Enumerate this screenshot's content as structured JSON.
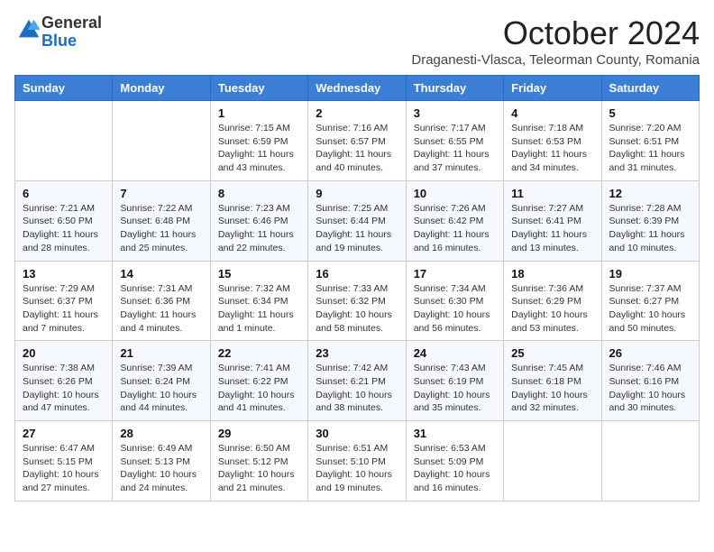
{
  "header": {
    "logo_general": "General",
    "logo_blue": "Blue",
    "month_title": "October 2024",
    "subtitle": "Draganesti-Vlasca, Teleorman County, Romania"
  },
  "days_of_week": [
    "Sunday",
    "Monday",
    "Tuesday",
    "Wednesday",
    "Thursday",
    "Friday",
    "Saturday"
  ],
  "weeks": [
    [
      {
        "day": "",
        "info": ""
      },
      {
        "day": "",
        "info": ""
      },
      {
        "day": "1",
        "info": "Sunrise: 7:15 AM\nSunset: 6:59 PM\nDaylight: 11 hours and 43 minutes."
      },
      {
        "day": "2",
        "info": "Sunrise: 7:16 AM\nSunset: 6:57 PM\nDaylight: 11 hours and 40 minutes."
      },
      {
        "day": "3",
        "info": "Sunrise: 7:17 AM\nSunset: 6:55 PM\nDaylight: 11 hours and 37 minutes."
      },
      {
        "day": "4",
        "info": "Sunrise: 7:18 AM\nSunset: 6:53 PM\nDaylight: 11 hours and 34 minutes."
      },
      {
        "day": "5",
        "info": "Sunrise: 7:20 AM\nSunset: 6:51 PM\nDaylight: 11 hours and 31 minutes."
      }
    ],
    [
      {
        "day": "6",
        "info": "Sunrise: 7:21 AM\nSunset: 6:50 PM\nDaylight: 11 hours and 28 minutes."
      },
      {
        "day": "7",
        "info": "Sunrise: 7:22 AM\nSunset: 6:48 PM\nDaylight: 11 hours and 25 minutes."
      },
      {
        "day": "8",
        "info": "Sunrise: 7:23 AM\nSunset: 6:46 PM\nDaylight: 11 hours and 22 minutes."
      },
      {
        "day": "9",
        "info": "Sunrise: 7:25 AM\nSunset: 6:44 PM\nDaylight: 11 hours and 19 minutes."
      },
      {
        "day": "10",
        "info": "Sunrise: 7:26 AM\nSunset: 6:42 PM\nDaylight: 11 hours and 16 minutes."
      },
      {
        "day": "11",
        "info": "Sunrise: 7:27 AM\nSunset: 6:41 PM\nDaylight: 11 hours and 13 minutes."
      },
      {
        "day": "12",
        "info": "Sunrise: 7:28 AM\nSunset: 6:39 PM\nDaylight: 11 hours and 10 minutes."
      }
    ],
    [
      {
        "day": "13",
        "info": "Sunrise: 7:29 AM\nSunset: 6:37 PM\nDaylight: 11 hours and 7 minutes."
      },
      {
        "day": "14",
        "info": "Sunrise: 7:31 AM\nSunset: 6:36 PM\nDaylight: 11 hours and 4 minutes."
      },
      {
        "day": "15",
        "info": "Sunrise: 7:32 AM\nSunset: 6:34 PM\nDaylight: 11 hours and 1 minute."
      },
      {
        "day": "16",
        "info": "Sunrise: 7:33 AM\nSunset: 6:32 PM\nDaylight: 10 hours and 58 minutes."
      },
      {
        "day": "17",
        "info": "Sunrise: 7:34 AM\nSunset: 6:30 PM\nDaylight: 10 hours and 56 minutes."
      },
      {
        "day": "18",
        "info": "Sunrise: 7:36 AM\nSunset: 6:29 PM\nDaylight: 10 hours and 53 minutes."
      },
      {
        "day": "19",
        "info": "Sunrise: 7:37 AM\nSunset: 6:27 PM\nDaylight: 10 hours and 50 minutes."
      }
    ],
    [
      {
        "day": "20",
        "info": "Sunrise: 7:38 AM\nSunset: 6:26 PM\nDaylight: 10 hours and 47 minutes."
      },
      {
        "day": "21",
        "info": "Sunrise: 7:39 AM\nSunset: 6:24 PM\nDaylight: 10 hours and 44 minutes."
      },
      {
        "day": "22",
        "info": "Sunrise: 7:41 AM\nSunset: 6:22 PM\nDaylight: 10 hours and 41 minutes."
      },
      {
        "day": "23",
        "info": "Sunrise: 7:42 AM\nSunset: 6:21 PM\nDaylight: 10 hours and 38 minutes."
      },
      {
        "day": "24",
        "info": "Sunrise: 7:43 AM\nSunset: 6:19 PM\nDaylight: 10 hours and 35 minutes."
      },
      {
        "day": "25",
        "info": "Sunrise: 7:45 AM\nSunset: 6:18 PM\nDaylight: 10 hours and 32 minutes."
      },
      {
        "day": "26",
        "info": "Sunrise: 7:46 AM\nSunset: 6:16 PM\nDaylight: 10 hours and 30 minutes."
      }
    ],
    [
      {
        "day": "27",
        "info": "Sunrise: 6:47 AM\nSunset: 5:15 PM\nDaylight: 10 hours and 27 minutes."
      },
      {
        "day": "28",
        "info": "Sunrise: 6:49 AM\nSunset: 5:13 PM\nDaylight: 10 hours and 24 minutes."
      },
      {
        "day": "29",
        "info": "Sunrise: 6:50 AM\nSunset: 5:12 PM\nDaylight: 10 hours and 21 minutes."
      },
      {
        "day": "30",
        "info": "Sunrise: 6:51 AM\nSunset: 5:10 PM\nDaylight: 10 hours and 19 minutes."
      },
      {
        "day": "31",
        "info": "Sunrise: 6:53 AM\nSunset: 5:09 PM\nDaylight: 10 hours and 16 minutes."
      },
      {
        "day": "",
        "info": ""
      },
      {
        "day": "",
        "info": ""
      }
    ]
  ]
}
